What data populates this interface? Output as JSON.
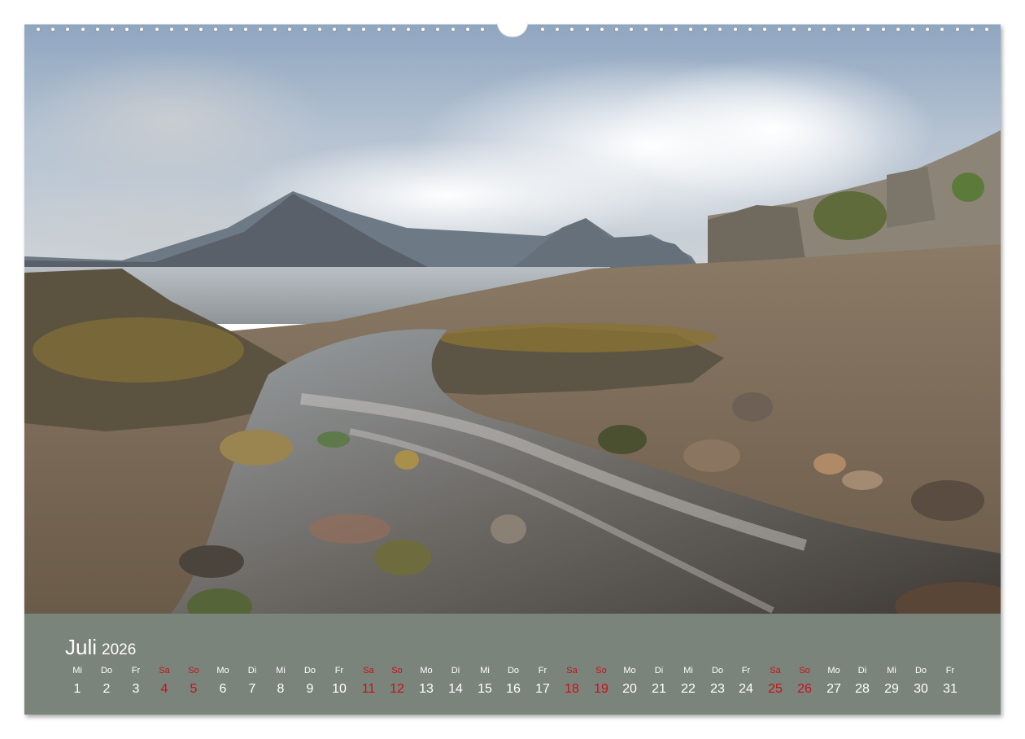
{
  "calendar": {
    "month": "Juli",
    "year": "2026",
    "weekend_color": "#c8101c",
    "band_color": "#7b847a",
    "days": [
      {
        "name": "Mi",
        "num": "1",
        "weekend": false
      },
      {
        "name": "Do",
        "num": "2",
        "weekend": false
      },
      {
        "name": "Fr",
        "num": "3",
        "weekend": false
      },
      {
        "name": "Sa",
        "num": "4",
        "weekend": true
      },
      {
        "name": "So",
        "num": "5",
        "weekend": true
      },
      {
        "name": "Mo",
        "num": "6",
        "weekend": false
      },
      {
        "name": "Di",
        "num": "7",
        "weekend": false
      },
      {
        "name": "Mi",
        "num": "8",
        "weekend": false
      },
      {
        "name": "Do",
        "num": "9",
        "weekend": false
      },
      {
        "name": "Fr",
        "num": "10",
        "weekend": false
      },
      {
        "name": "Sa",
        "num": "11",
        "weekend": true
      },
      {
        "name": "So",
        "num": "12",
        "weekend": true
      },
      {
        "name": "Mo",
        "num": "13",
        "weekend": false
      },
      {
        "name": "Di",
        "num": "14",
        "weekend": false
      },
      {
        "name": "Mi",
        "num": "15",
        "weekend": false
      },
      {
        "name": "Do",
        "num": "16",
        "weekend": false
      },
      {
        "name": "Fr",
        "num": "17",
        "weekend": false
      },
      {
        "name": "Sa",
        "num": "18",
        "weekend": true
      },
      {
        "name": "So",
        "num": "19",
        "weekend": true
      },
      {
        "name": "Mo",
        "num": "20",
        "weekend": false
      },
      {
        "name": "Di",
        "num": "21",
        "weekend": false
      },
      {
        "name": "Mi",
        "num": "22",
        "weekend": false
      },
      {
        "name": "Do",
        "num": "23",
        "weekend": false
      },
      {
        "name": "Fr",
        "num": "24",
        "weekend": false
      },
      {
        "name": "Sa",
        "num": "25",
        "weekend": true
      },
      {
        "name": "So",
        "num": "26",
        "weekend": true
      },
      {
        "name": "Mo",
        "num": "27",
        "weekend": false
      },
      {
        "name": "Di",
        "num": "28",
        "weekend": false
      },
      {
        "name": "Mi",
        "num": "29",
        "weekend": false
      },
      {
        "name": "Do",
        "num": "30",
        "weekend": false
      },
      {
        "name": "Fr",
        "num": "31",
        "weekend": false
      }
    ]
  }
}
